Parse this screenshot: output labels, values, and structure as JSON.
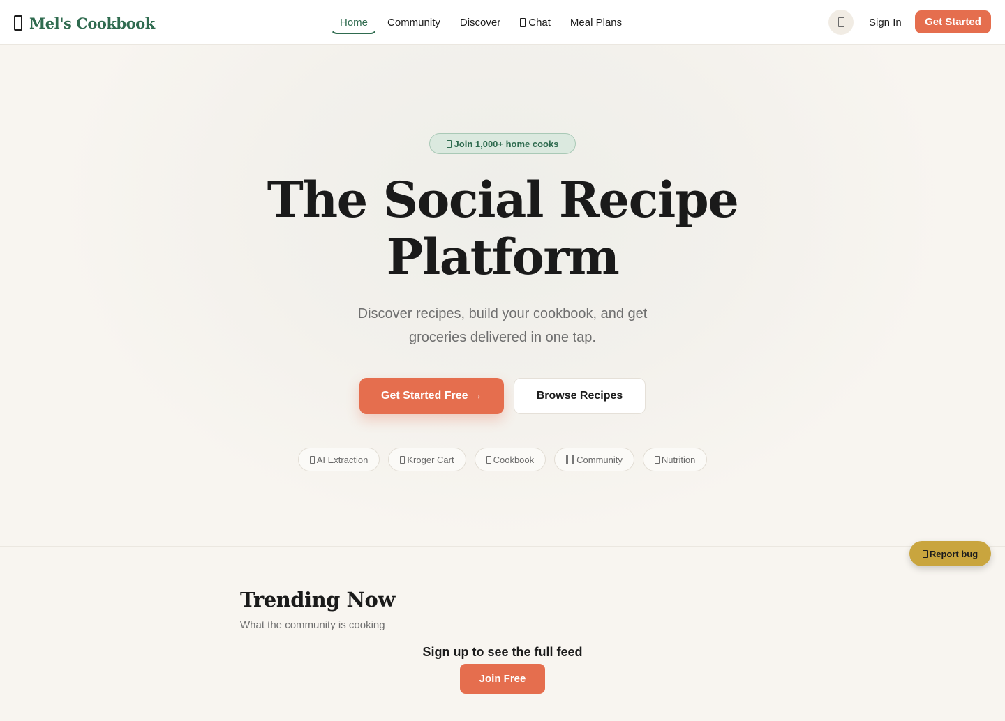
{
  "brand": {
    "name": "Mel's Cookbook",
    "icon": "book-icon",
    "accent": "#2f6b4f"
  },
  "nav": {
    "items": [
      {
        "label": "Home",
        "active": true
      },
      {
        "label": "Community"
      },
      {
        "label": "Discover"
      },
      {
        "label": "Chat",
        "icon": "chat-icon"
      },
      {
        "label": "Meal Plans"
      }
    ],
    "theme_icon": "moon-icon",
    "sign_in": "Sign In",
    "get_started": "Get Started"
  },
  "hero": {
    "badge": "Join 1,000+ home cooks",
    "title_line1": "The Social Recipe",
    "title_line2": "Platform",
    "subtitle": "Discover recipes, build your cookbook, and get groceries delivered in one tap.",
    "primary_cta": "Get Started Free →",
    "secondary_cta": "Browse Recipes",
    "features": [
      {
        "label": "AI Extraction",
        "icon": "sparkle-icon"
      },
      {
        "label": "Kroger Cart",
        "icon": "cart-icon"
      },
      {
        "label": "Cookbook",
        "icon": "book-icon"
      },
      {
        "label": "Community",
        "icon": "people-icon"
      },
      {
        "label": "Nutrition",
        "icon": "chart-icon"
      }
    ]
  },
  "trending": {
    "title": "Trending Now",
    "subtitle": "What the community is cooking",
    "signup_prompt": "Sign up to see the full feed",
    "join_button": "Join Free"
  },
  "report_bug": {
    "label": "Report bug",
    "icon": "bug-icon",
    "color": "#c9a53e"
  },
  "colors": {
    "cta": "#e56e4e",
    "background": "#f8f5f0"
  }
}
